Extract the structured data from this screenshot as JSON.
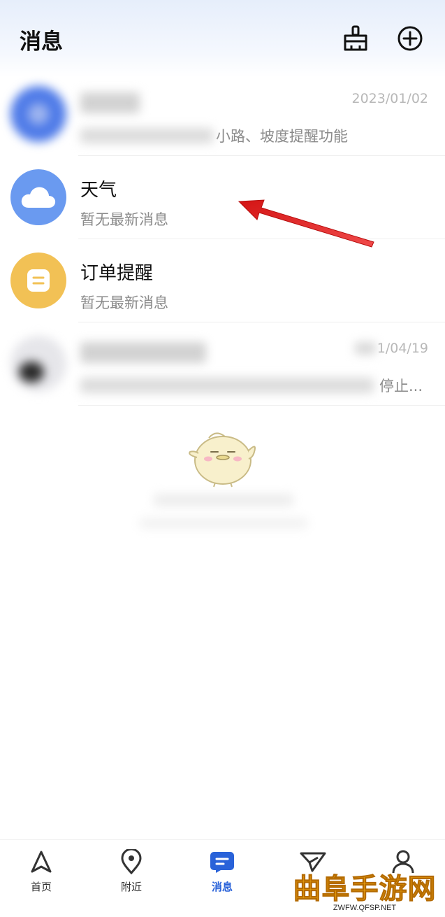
{
  "header": {
    "title": "消息",
    "clean_icon": "broom-icon",
    "add_icon": "plus-circle-icon"
  },
  "messages": [
    {
      "title": "",
      "subtitle_visible": "小路、坡度提醒功能",
      "time": "2023/01/02",
      "avatar_color": "#4f7be8",
      "blurred": true
    },
    {
      "title": "天气",
      "subtitle": "暂无最新消息",
      "avatar_icon": "cloud-icon",
      "avatar_color": "#6a9af0"
    },
    {
      "title": "订单提醒",
      "subtitle": "暂无最新消息",
      "avatar_icon": "order-icon",
      "avatar_color": "#f2c155"
    },
    {
      "title": "",
      "subtitle_visible": "停止...",
      "time": "1/04/19",
      "blurred": true
    }
  ],
  "tabs": [
    {
      "label": "首页",
      "icon": "navigation-arrow-icon",
      "active": false
    },
    {
      "label": "附近",
      "icon": "location-pin-icon",
      "active": false
    },
    {
      "label": "消息",
      "icon": "message-icon",
      "active": true
    },
    {
      "label": "",
      "icon": "paper-plane-icon",
      "active": false
    },
    {
      "label": "",
      "icon": "user-icon",
      "active": false
    }
  ],
  "watermark": {
    "text": "曲阜手游网",
    "url": "ZWFW.QFSP.NET"
  },
  "colors": {
    "accent": "#2962d9",
    "annotation_arrow": "#e01818"
  }
}
